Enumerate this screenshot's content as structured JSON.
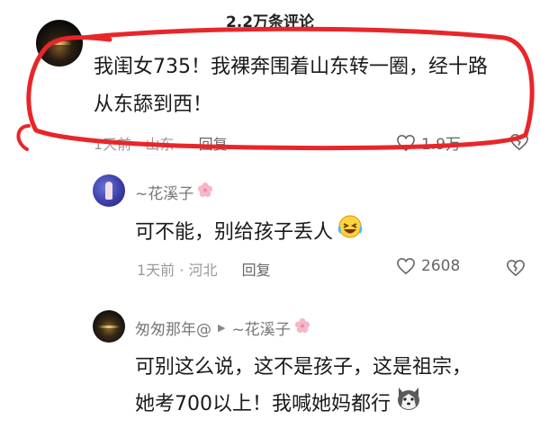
{
  "header": {
    "title": "2.2万条评论"
  },
  "main_comment": {
    "text_line1": "我闺女735！我裸奔围着山东转一圈，经十路",
    "text_line2": "从东舔到西！",
    "time": "1天前",
    "location": "山东",
    "reply_label": "回复",
    "likes": "1.9万"
  },
  "replies": [
    {
      "username": "~花溪子",
      "text": "可不能，别给孩子丢人",
      "time": "1天前",
      "location": "河北",
      "reply_label": "回复",
      "likes": "2608"
    },
    {
      "username": "匆匆那年@",
      "reply_to": "~花溪子",
      "text_line1": "可别这么说，这不是孩子，这是祖宗，",
      "text_line2": "她考700以上！我喊她妈都行"
    }
  ],
  "colors": {
    "annotation": "#e8262a",
    "meta_text": "#999999",
    "body_text": "#1a1a1a"
  }
}
